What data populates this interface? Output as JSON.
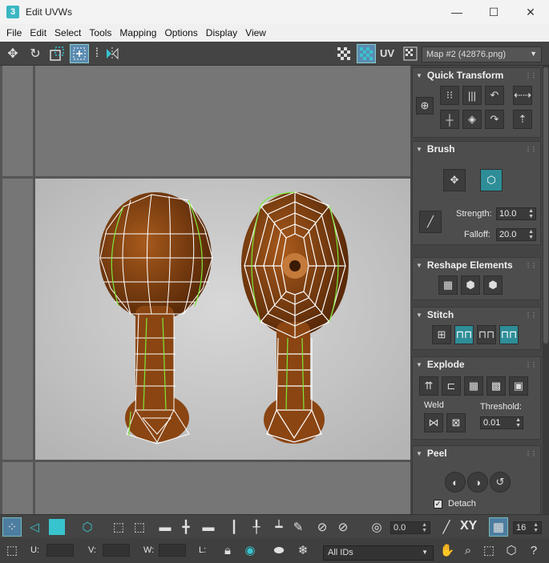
{
  "window": {
    "title": "Edit UVWs",
    "app_icon": "3",
    "minimize": "—",
    "maximize": "☐",
    "close": "✕"
  },
  "menu": [
    "File",
    "Edit",
    "Select",
    "Tools",
    "Mapping",
    "Options",
    "Display",
    "View"
  ],
  "toolbar": {
    "uv_label": "UV",
    "map_select": "Map #2 (42876.png)"
  },
  "panel": {
    "quick_transform": {
      "title": "Quick Transform"
    },
    "brush": {
      "title": "Brush",
      "strength_label": "Strength:",
      "strength_value": "10.0",
      "falloff_label": "Falloff:",
      "falloff_value": "20.0"
    },
    "reshape": {
      "title": "Reshape Elements"
    },
    "stitch": {
      "title": "Stitch"
    },
    "explode": {
      "title": "Explode",
      "weld_label": "Weld",
      "threshold_label": "Threshold:",
      "threshold_value": "0.01"
    },
    "peel": {
      "title": "Peel",
      "detach_label": "Detach",
      "detach_checked": true
    }
  },
  "bottom": {
    "angle_value": "0.0",
    "xy_label": "XY",
    "grid_value": "16",
    "u_label": "U:",
    "u_value": "",
    "v_label": "V:",
    "v_value": "",
    "w_label": "W:",
    "w_value": "",
    "l_label": "L:",
    "ids_select": "All IDs"
  },
  "colors": {
    "accent": "#38c4cf",
    "panel_bg": "#444444",
    "viewport_bg": "#767676",
    "canvas_bg": "#cacaca",
    "mesh_edge": "#ffffff",
    "seam": "#7ee83a",
    "drumstick": "#7a3a0e"
  }
}
